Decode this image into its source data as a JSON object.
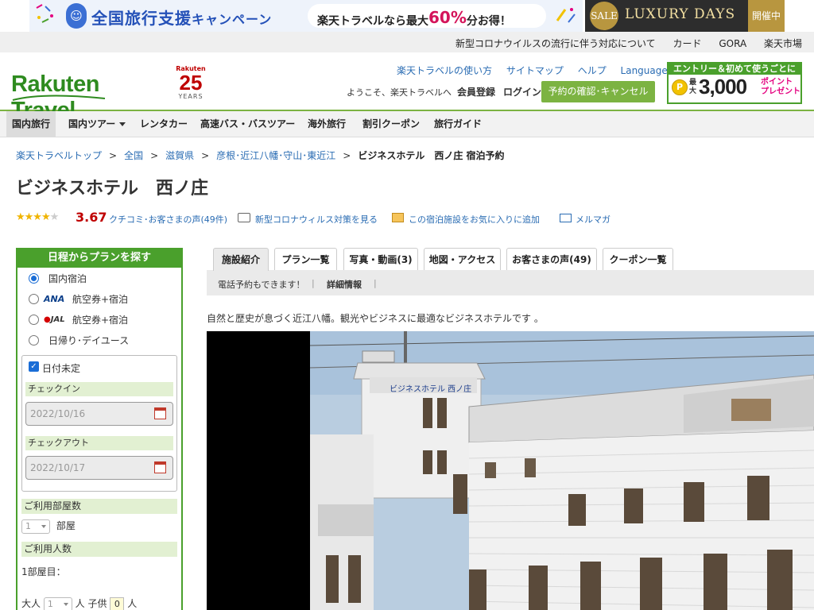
{
  "banner": {
    "campaign": "全国旅行支援",
    "campaign_suffix": "キャンペーン",
    "pill_prefix": "楽天トラベルなら最大",
    "pill_pct": "60%",
    "pill_suffix": "分お得！",
    "sale_circle": "SALE",
    "sale_text": "LUXURY DAYS",
    "sale_tag": "開催中"
  },
  "utility_links": [
    "新型コロナウイルスの流行に伴う対応について",
    "カード",
    "GORA",
    "楽天市場"
  ],
  "header": {
    "logo": "Rakuten Travel",
    "anniv_brand": "Rakuten",
    "anniv_num": "25",
    "anniv_years": "YEARS",
    "links": [
      "楽天トラベルの使い方",
      "サイトマップ",
      "ヘルプ"
    ],
    "languages": "Languages",
    "welcome": "ようこそ、楽天トラベルへ",
    "member": "会員登録",
    "login": "ログイン",
    "reserve_btn": "予約の確認･キャンセル",
    "promo_top": "エントリー＆初めて使うごとに",
    "promo_coin": "P",
    "promo_small": "最大",
    "promo_num": "3,000",
    "promo_pt1": "ポイント",
    "promo_pt2": "プレゼント"
  },
  "gnav": [
    "国内旅行",
    "国内ツアー",
    "レンタカー",
    "高速バス・バスツアー",
    "海外旅行",
    "割引クーポン",
    "旅行ガイド"
  ],
  "breadcrumb": [
    "楽天トラベルトップ",
    "全国",
    "滋賀県",
    "彦根･近江八幡･守山･東近江"
  ],
  "breadcrumb_sep": ">",
  "breadcrumb_current": "ビジネスホテル　西ノ庄 宿泊予約",
  "hotel_name": "ビジネスホテル　西ノ庄",
  "rating": {
    "stars": 4,
    "value": "3.67",
    "reviews_link": "クチコミ･お客さまの声(49件)",
    "covid_link": "新型コロナウィルス対策を見る",
    "fav_link": "この宿泊施設をお気に入りに追加",
    "mail_link": "メルマガ"
  },
  "search": {
    "title": "日程からプランを探す",
    "options": [
      {
        "label": "国内宿泊",
        "selected": true
      },
      {
        "brand": "ANA",
        "label": "航空券+宿泊",
        "selected": false
      },
      {
        "brand": "JAL",
        "label": "航空券+宿泊",
        "selected": false
      },
      {
        "label": "日帰り･デイユース",
        "selected": false
      }
    ],
    "undecided_label": "日付未定",
    "undecided_checked": true,
    "checkin_label": "チェックイン",
    "checkin_value": "2022/10/16",
    "checkout_label": "チェックアウト",
    "checkout_value": "2022/10/17",
    "rooms_label": "ご利用部屋数",
    "rooms_value": "1",
    "rooms_unit": "部屋",
    "people_label": "ご利用人数",
    "room1_label": "1部屋目：",
    "adult_label": "大人",
    "adult_value": "1",
    "person_unit": "人",
    "child_label": "子供",
    "child_value": "0",
    "child_unit": "人"
  },
  "tabs": [
    "施設紹介",
    "プラン一覧",
    "写真・動画(3)",
    "地図・アクセス",
    "お客さまの声(49)",
    "クーポン一覧"
  ],
  "subtabs": [
    "電話予約もできます！",
    "詳細情報"
  ],
  "intro": "自然と歴史が息づく近江八幡。観光やビジネスに最適なビジネスホテルです 。",
  "photo_sign": "ビジネスホテル 西ノ庄",
  "colors": {
    "accent_green": "#4aa02c",
    "brand_red": "#bf0000",
    "link_blue": "#2a6cb3"
  }
}
